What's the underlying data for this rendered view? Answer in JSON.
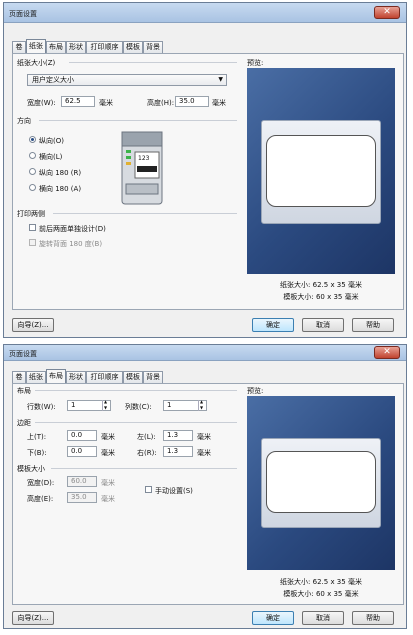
{
  "top": {
    "title": "页面设置",
    "close": "✕",
    "tabs": [
      "卷",
      "纸张",
      "布局",
      "形状",
      "打印顺序",
      "模板",
      "背景"
    ],
    "paper_group": "纸张大小(Z)",
    "paper_select": "用户定义大小",
    "width_label": "宽度(W):",
    "width_value": "62.5",
    "height_label": "高度(H):",
    "height_value": "35.0",
    "unit": "毫米",
    "orient_group": "方向",
    "orient": [
      "纵向(O)",
      "横向(L)",
      "纵向 180 (R)",
      "横向 180 (A)"
    ],
    "print_group": "打印两侧",
    "duplex": "前后两面单独设计(D)",
    "rotate": "旋转背面 180 度(B)",
    "preview_label": "预览:",
    "paper_size": "纸张大小: 62.5 x 35 毫米",
    "template_size": "模板大小: 60 x 35 毫米",
    "printer_text": "123",
    "wizard": "向导(Z)...",
    "ok": "确定",
    "cancel": "取消",
    "help": "帮助"
  },
  "bottom": {
    "title": "页面设置",
    "close": "✕",
    "tabs": [
      "卷",
      "纸张",
      "布局",
      "形状",
      "打印顺序",
      "模板",
      "背景"
    ],
    "layout_group": "布局",
    "rows_label": "行数(W):",
    "rows_value": "1",
    "cols_label": "列数(C):",
    "cols_value": "1",
    "margin_group": "边距",
    "top_label": "上(T):",
    "top_value": "0.0",
    "left_label": "左(L):",
    "left_value": "1.3",
    "bottom_label": "下(B):",
    "bottom_value": "0.0",
    "right_label": "右(R):",
    "right_value": "1.3",
    "unit": "毫米",
    "tpl_group": "模板大小",
    "w_label": "宽度(D):",
    "w_value": "60.0",
    "h_label": "高度(E):",
    "h_value": "35.0",
    "manual": "手动设置(S)",
    "preview_label": "预览:",
    "paper_size": "纸张大小: 62.5 x 35 毫米",
    "template_size": "模板大小: 60 x 35 毫米",
    "wizard": "向导(Z)...",
    "ok": "确定",
    "cancel": "取消",
    "help": "帮助"
  }
}
